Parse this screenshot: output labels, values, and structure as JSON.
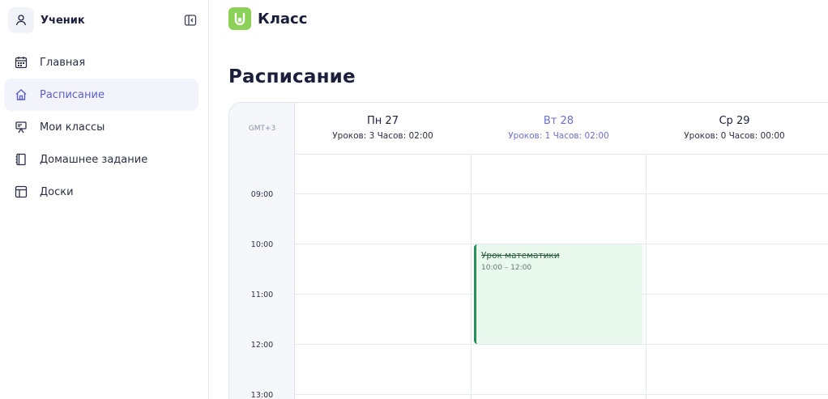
{
  "sidebar": {
    "user": {
      "name": "Ученик",
      "icon": "user-icon"
    },
    "collapse_icon": "sidebar-collapse-icon",
    "items": [
      {
        "label": "Главная",
        "icon": "calendar-grid-icon",
        "active": false
      },
      {
        "label": "Расписание",
        "icon": "home-icon",
        "active": true
      },
      {
        "label": "Мои классы",
        "icon": "presentation-board-icon",
        "active": false
      },
      {
        "label": "Домашнее задание",
        "icon": "notebook-icon",
        "active": false
      },
      {
        "label": "Доски",
        "icon": "layout-board-icon",
        "active": false
      }
    ]
  },
  "header": {
    "app_name": "Класс",
    "logo_icon": "class-logo-icon",
    "logo_color": "#8cd15a"
  },
  "page": {
    "title": "Расписание"
  },
  "calendar": {
    "timezone": "GMT+3",
    "days": [
      {
        "name": "Пн 27",
        "stats": "Уроков: 3 Часов: 02:00",
        "today": false
      },
      {
        "name": "Вт 28",
        "stats": "Уроков: 1 Часов: 02:00",
        "today": true
      },
      {
        "name": "Ср 29",
        "stats": "Уроков: 0 Часов: 00:00",
        "today": false
      }
    ],
    "times": [
      "09:00",
      "10:00",
      "11:00",
      "12:00",
      "13:00"
    ],
    "events": [
      {
        "title": "Урок математики",
        "time": "10:00 – 12:00",
        "day": "Вт 28",
        "cancelled": true
      }
    ]
  },
  "colors": {
    "accent": "#5b5fc7",
    "event_bg": "#e9f9ee",
    "event_border": "#27935a"
  }
}
